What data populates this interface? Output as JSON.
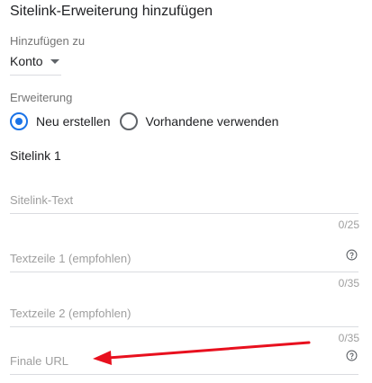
{
  "page": {
    "title": "Sitelink-Erweiterung hinzufügen"
  },
  "add_to": {
    "label": "Hinzufügen zu",
    "selected": "Konto"
  },
  "extension": {
    "label": "Erweiterung",
    "options": [
      {
        "label": "Neu erstellen",
        "selected": true
      },
      {
        "label": "Vorhandene verwenden",
        "selected": false
      }
    ]
  },
  "sitelink": {
    "heading": "Sitelink 1",
    "fields": {
      "text": {
        "placeholder": "Sitelink-Text",
        "counter": "0/25"
      },
      "line1": {
        "placeholder": "Textzeile 1 (empfohlen)",
        "counter": "0/35"
      },
      "line2": {
        "placeholder": "Textzeile 2 (empfohlen)",
        "counter": "0/35"
      },
      "final_url": {
        "placeholder": "Finale URL"
      }
    }
  },
  "icons": {
    "help": "help-circle-icon",
    "dropdown": "caret-down-icon",
    "annotation": "red-arrow"
  },
  "colors": {
    "accent": "#1a73e8",
    "annotation_arrow": "#e8101e"
  }
}
